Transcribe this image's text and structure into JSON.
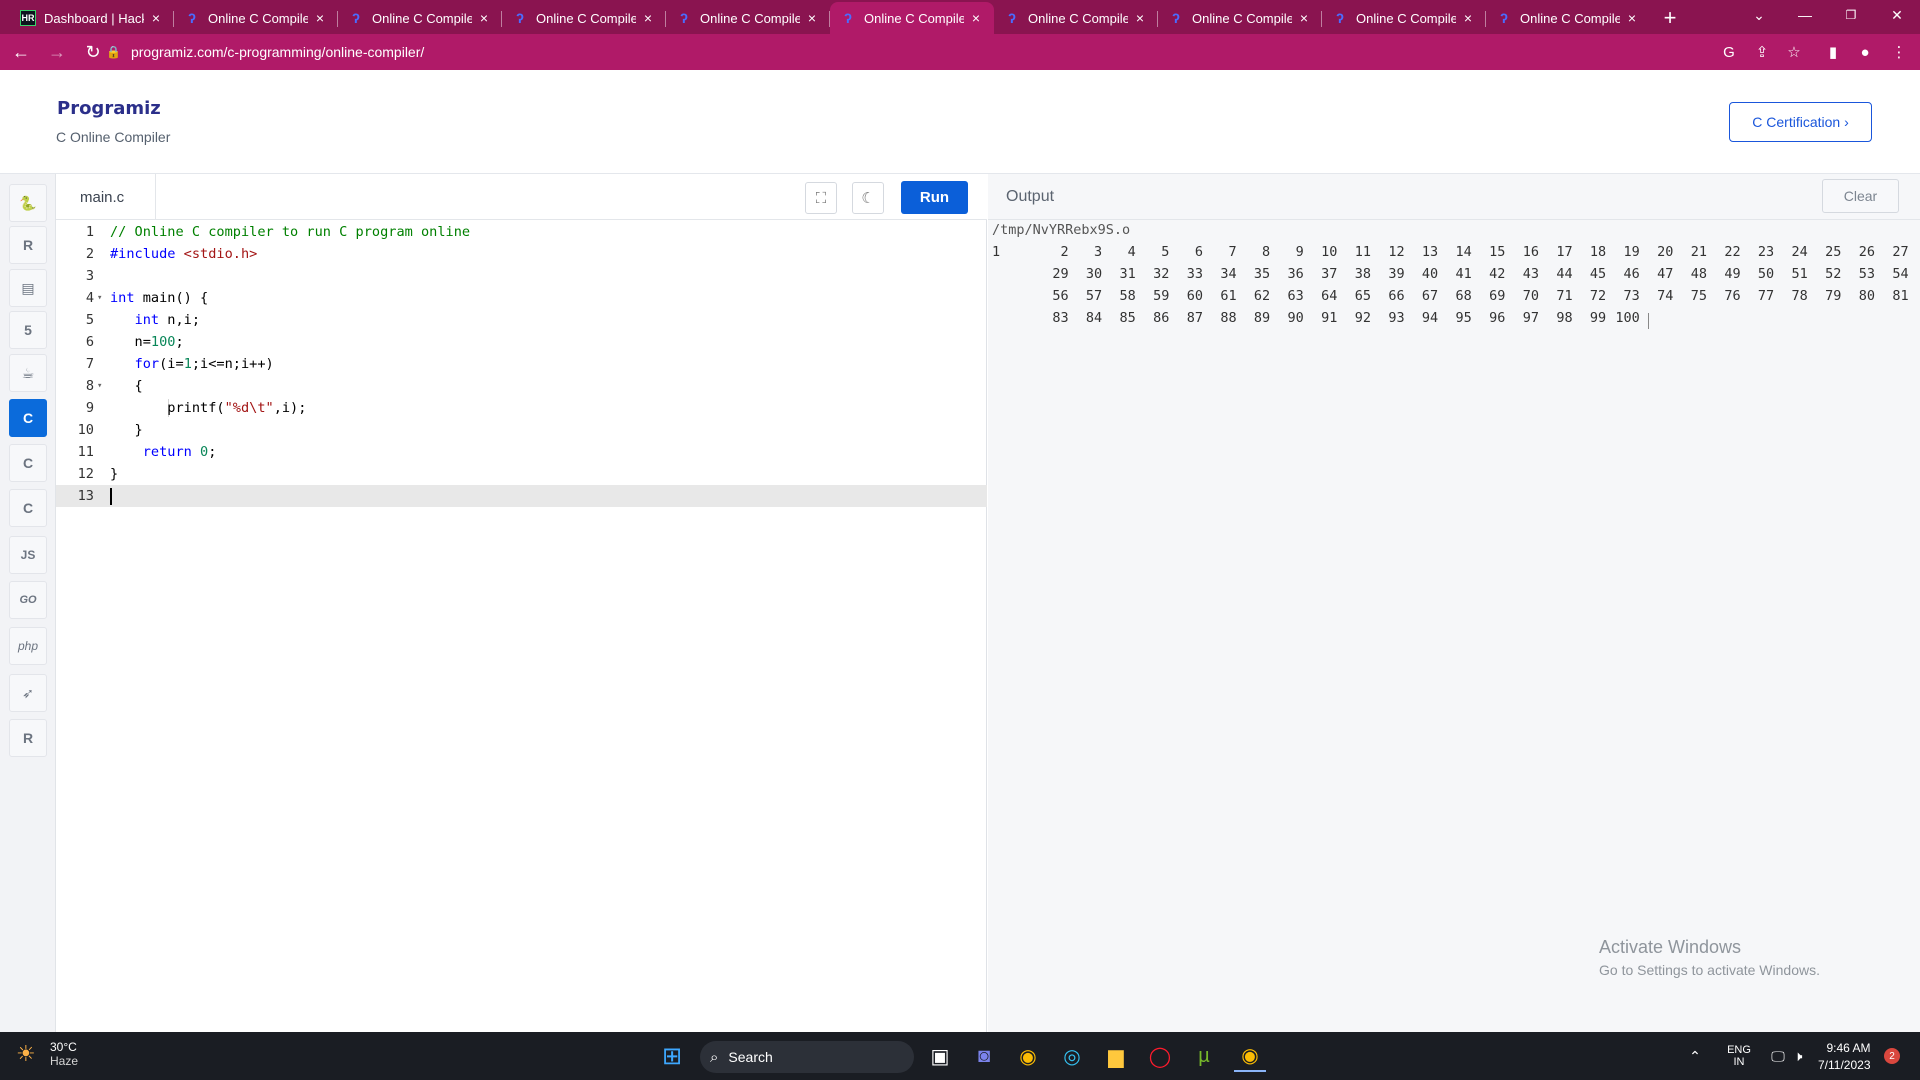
{
  "browser": {
    "tabs": [
      {
        "title": "Dashboard | HackerRank",
        "favicon": "hackerrank-icon"
      },
      {
        "title": "Online C Compiler",
        "favicon": "programiz-icon"
      },
      {
        "title": "Online C Compiler",
        "favicon": "programiz-icon"
      },
      {
        "title": "Online C Compiler",
        "favicon": "programiz-icon"
      },
      {
        "title": "Online C Compiler",
        "favicon": "programiz-icon"
      },
      {
        "title": "Online C Compiler",
        "favicon": "programiz-icon",
        "active": true
      },
      {
        "title": "Online C Compiler",
        "favicon": "programiz-icon"
      },
      {
        "title": "Online C Compiler",
        "favicon": "programiz-icon"
      },
      {
        "title": "Online C Compiler",
        "favicon": "programiz-icon"
      },
      {
        "title": "Online C Compiler",
        "favicon": "programiz-icon"
      }
    ],
    "tab_close_glyph": "×",
    "new_tab_glyph": "+",
    "url": "programiz.com/c-programming/online-compiler/",
    "colors": {
      "tabbar": "#8a1450",
      "toolbar": "#b01a68"
    }
  },
  "page": {
    "logo": "Programiz",
    "subtitle": "C Online Compiler",
    "cert_button": "C Certification ›"
  },
  "rail": {
    "items": [
      "python-icon",
      "r-icon",
      "sql-icon",
      "html-icon",
      "java-icon",
      "c-icon",
      "cpp-icon",
      "csharp-icon",
      "js-icon",
      "go-icon",
      "php-icon",
      "swift-icon",
      "rust-icon"
    ],
    "active": "c-icon",
    "labels": {
      "js": "JS",
      "go": "GO",
      "php": "php"
    }
  },
  "editor": {
    "filename": "main.c",
    "run_label": "Run",
    "lines": [
      {
        "n": "1",
        "html": "<span class=\"c\">// Online C compiler to run C program online</span>"
      },
      {
        "n": "2",
        "html": "<span class=\"k\">#include</span> <span class=\"s\">&lt;stdio.h&gt;</span>"
      },
      {
        "n": "3",
        "html": ""
      },
      {
        "n": "4",
        "fold": true,
        "html": "<span class=\"k\">int</span> main() {"
      },
      {
        "n": "5",
        "html": "   <span class=\"k\">int</span> n,i;"
      },
      {
        "n": "6",
        "html": "   n=<span class=\"n\">100</span>;"
      },
      {
        "n": "7",
        "html": "   <span class=\"k\">for</span>(i=<span class=\"n\">1</span>;i&lt;=n;i++)"
      },
      {
        "n": "8",
        "fold": true,
        "html": "   {"
      },
      {
        "n": "9",
        "guide": true,
        "html": "       printf(<span class=\"s\">\"%d\\t\"</span>,i);"
      },
      {
        "n": "10",
        "html": "   }"
      },
      {
        "n": "11",
        "html": "    <span class=\"k\">return</span> <span class=\"n\">0</span>;"
      },
      {
        "n": "12",
        "html": "}"
      },
      {
        "n": "13",
        "current": true,
        "html": ""
      }
    ]
  },
  "output": {
    "title": "Output",
    "clear_label": "Clear",
    "path": "/tmp/NvYRRebx9S.o",
    "numbers_from": 1,
    "numbers_to": 100
  },
  "watermark": {
    "line1": "Activate Windows",
    "line2": "Go to Settings to activate Windows."
  },
  "taskbar": {
    "weather_temp": "30°C",
    "weather_desc": "Haze",
    "search_placeholder": "Search",
    "lang_1": "ENG",
    "lang_2": "IN",
    "time": "9:46 AM",
    "date": "7/11/2023",
    "notifications": "2"
  }
}
